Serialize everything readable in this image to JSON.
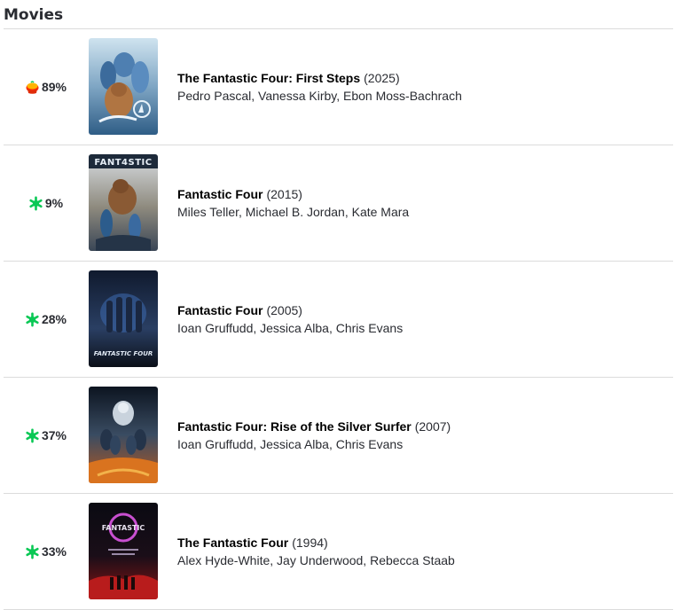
{
  "section_title": "Movies",
  "colors": {
    "fresh": "#fa320a",
    "rotten": "#0ac855",
    "divider": "#dcdcdc"
  },
  "movies": [
    {
      "score": "89%",
      "score_icon": "popcorn-fresh-icon",
      "title": "The Fantastic Four: First Steps",
      "year": "(2025)",
      "cast": "Pedro Pascal, Vanessa Kirby, Ebon Moss-Bachrach"
    },
    {
      "score": "9%",
      "score_icon": "rotten-splat-icon",
      "title": "Fantastic Four",
      "year": "(2015)",
      "cast": "Miles Teller, Michael B. Jordan, Kate Mara",
      "poster_text": "FANT4STIC"
    },
    {
      "score": "28%",
      "score_icon": "rotten-splat-icon",
      "title": "Fantastic Four",
      "year": "(2005)",
      "cast": "Ioan Gruffudd, Jessica Alba, Chris Evans",
      "poster_text": "FANTASTIC FOUR"
    },
    {
      "score": "37%",
      "score_icon": "rotten-splat-icon",
      "title": "Fantastic Four: Rise of the Silver Surfer",
      "year": "(2007)",
      "cast": "Ioan Gruffudd, Jessica Alba, Chris Evans"
    },
    {
      "score": "33%",
      "score_icon": "rotten-splat-icon",
      "title": "The Fantastic Four",
      "year": "(1994)",
      "cast": "Alex Hyde-White, Jay Underwood, Rebecca Staab",
      "poster_text": "FANTASTIC"
    }
  ]
}
